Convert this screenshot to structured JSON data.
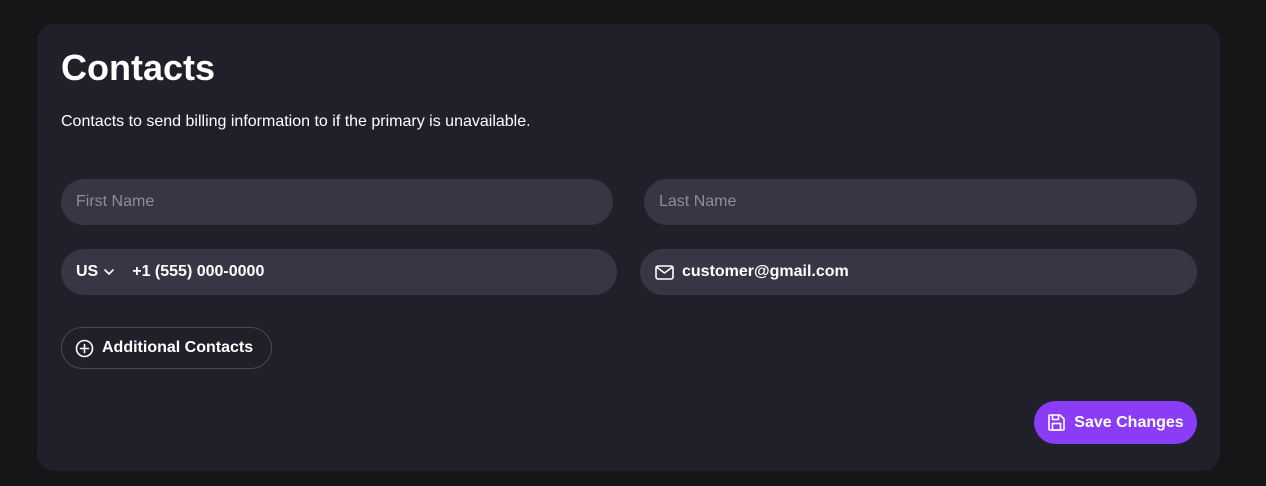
{
  "section": {
    "title": "Contacts",
    "description": "Contacts to send billing information to if the primary is unavailable."
  },
  "fields": {
    "first_name": {
      "placeholder": "First Name",
      "value": ""
    },
    "last_name": {
      "placeholder": "Last Name",
      "value": ""
    },
    "phone": {
      "country": "US",
      "number": "+1 (555) 000-0000"
    },
    "email": {
      "value": "customer@gmail.com"
    }
  },
  "actions": {
    "additional_contacts_label": "Additional Contacts",
    "save_label": "Save Changes"
  },
  "icons": {
    "country_dropdown": "chevron-down-icon",
    "email": "mail-icon",
    "additional": "plus-circle-icon",
    "save": "floppy-disk-icon"
  },
  "colors": {
    "background": "#161618",
    "card": "#20202a",
    "field": "#363645",
    "accent": "#8b3cf6"
  }
}
